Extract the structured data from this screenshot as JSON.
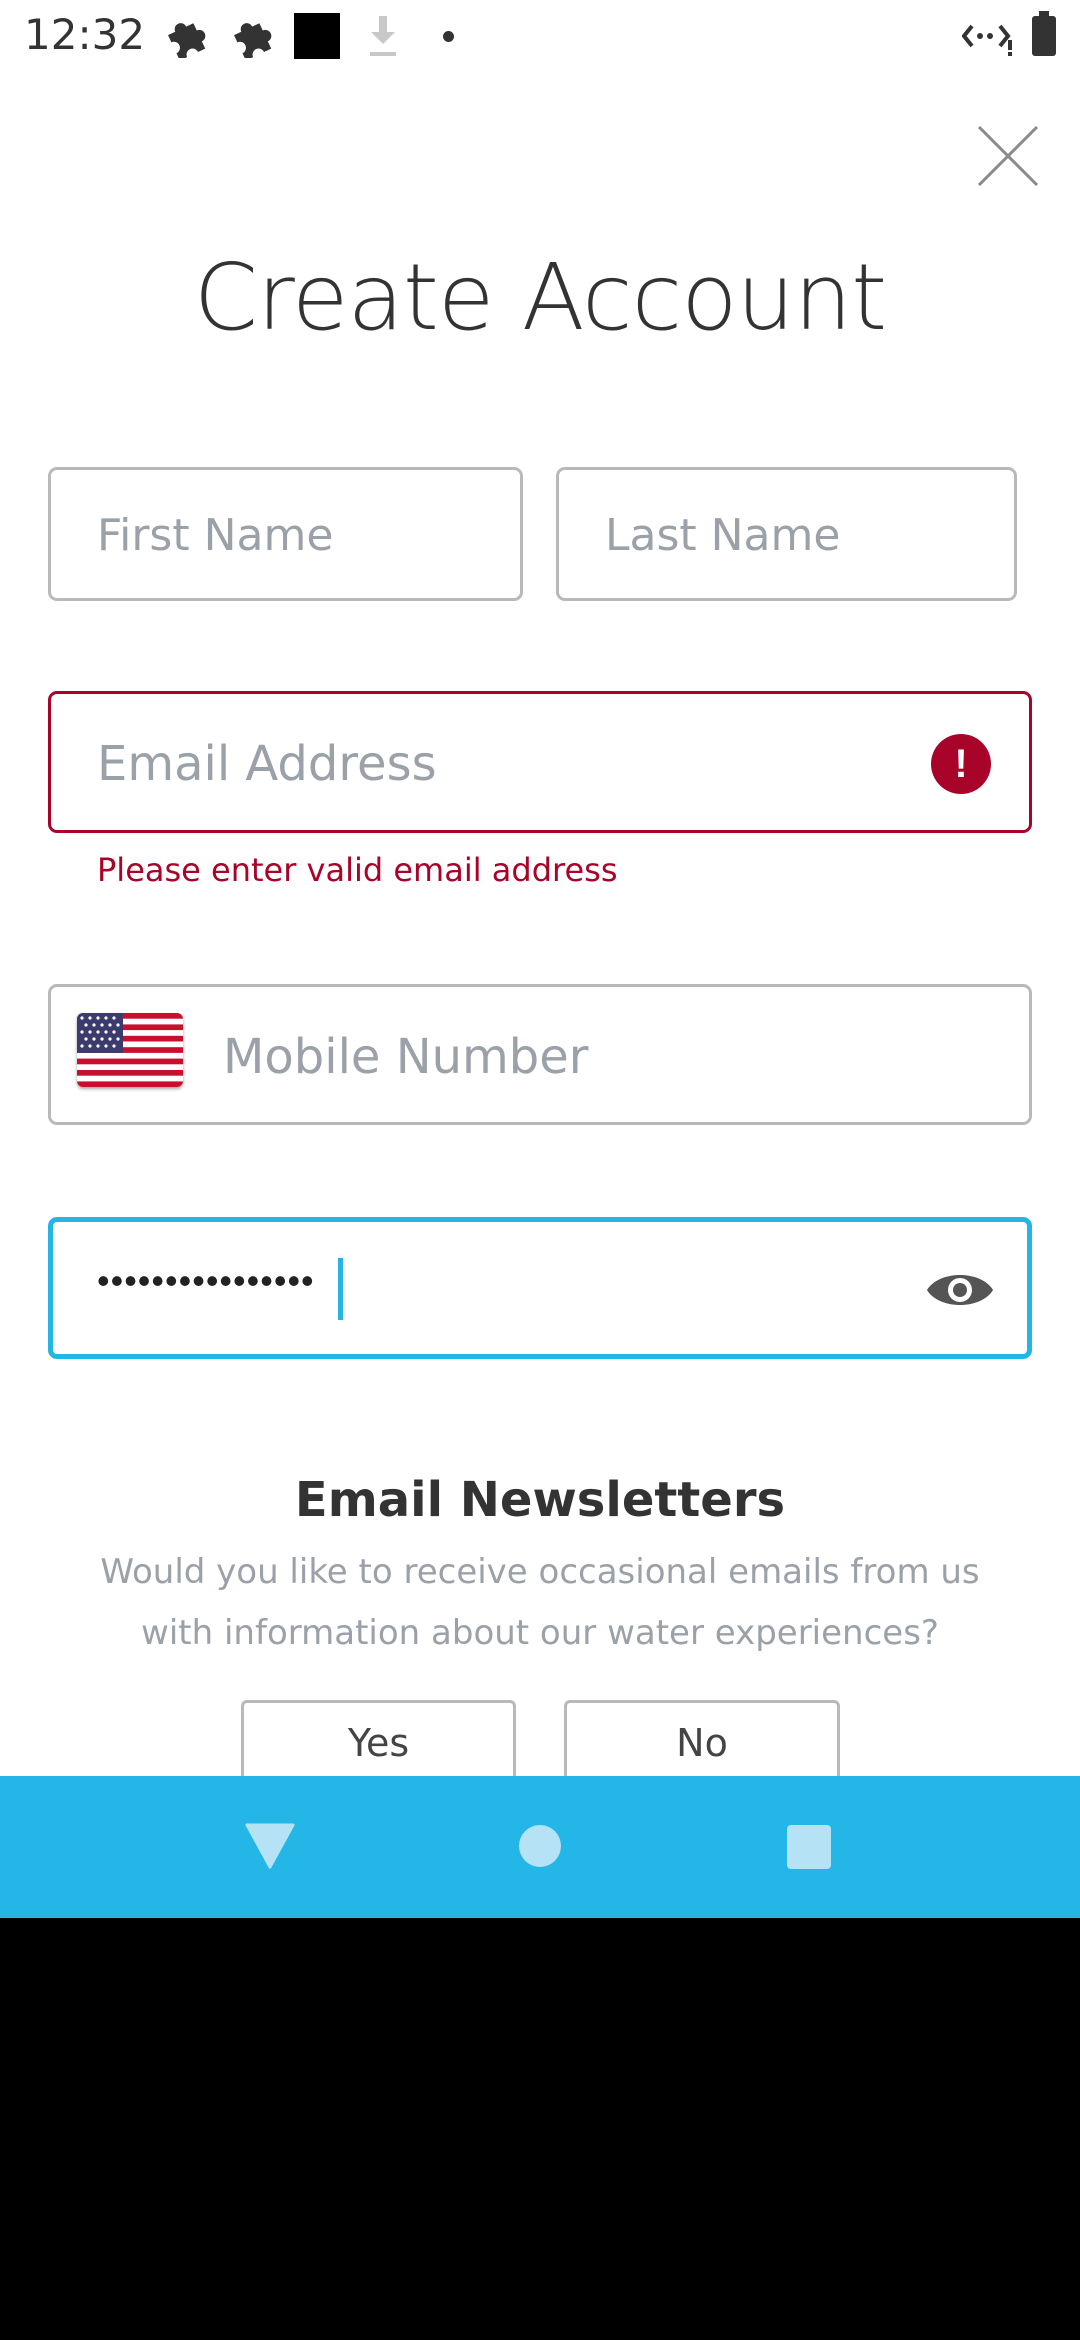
{
  "status_bar": {
    "time": "12:32",
    "icons": [
      "puzzle-icon",
      "puzzle-icon",
      "square-icon",
      "download-icon",
      "dot-icon",
      "data-saver-icon",
      "battery-icon"
    ]
  },
  "close": {
    "icon": "close-icon"
  },
  "title": "Create Account",
  "form": {
    "first_name": {
      "placeholder": "First Name",
      "value": ""
    },
    "last_name": {
      "placeholder": "Last Name",
      "value": ""
    },
    "email": {
      "placeholder": "Email Address",
      "value": "",
      "error": "Please enter valid email address",
      "error_icon_glyph": "!"
    },
    "mobile": {
      "placeholder": "Mobile Number",
      "value": "",
      "country_flag": "us-flag-icon"
    },
    "password": {
      "value": "••••••••••••••••",
      "reveal_icon": "eye-icon"
    }
  },
  "newsletter": {
    "title": "Email Newsletters",
    "text": "Would you like to receive occasional emails from us with information about our water experiences?",
    "yes_label": "Yes",
    "no_label": "No"
  },
  "nav_bar": {
    "back": "back-triangle-icon",
    "home": "home-circle-icon",
    "recent": "recents-square-icon"
  },
  "colors": {
    "accent": "#24b6e6",
    "error": "#a8042a",
    "placeholder": "#9aa1a8",
    "border": "#b9b9b9"
  }
}
